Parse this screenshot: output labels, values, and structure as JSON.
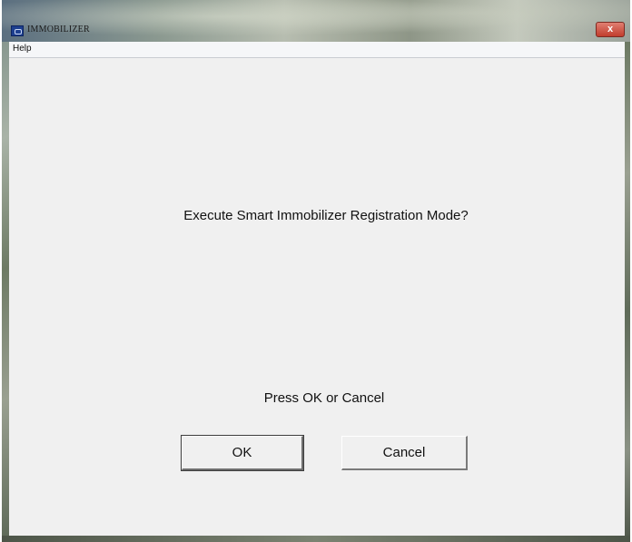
{
  "window": {
    "title": "IMMOBILIZER",
    "close_glyph": "x",
    "icon": "app-icon"
  },
  "menubar": {
    "items": [
      {
        "label": "Help"
      }
    ]
  },
  "dialog": {
    "question": "Execute Smart Immobilizer Registration Mode?",
    "prompt": "Press OK or Cancel",
    "ok_label": "OK",
    "cancel_label": "Cancel"
  },
  "colors": {
    "client_background": "#f0f0f0",
    "close_button": "#c23d2d",
    "menubar_background": "#f5f6f8"
  }
}
